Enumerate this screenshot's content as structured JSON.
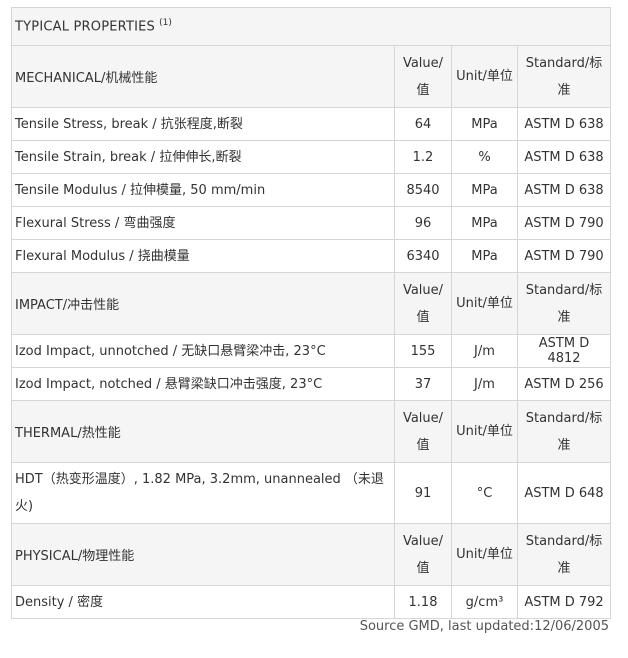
{
  "title": "TYPICAL PROPERTIES",
  "title_note": "(1)",
  "sections": [
    {
      "name": "MECHANICAL/机械性能",
      "col_value": "Value/值",
      "col_unit": "Unit/单位",
      "col_standard": "Standard/标准",
      "rows": [
        {
          "property": "Tensile Stress, break / 抗张程度,断裂",
          "value": "64",
          "unit": "MPa",
          "standard": "ASTM D 638"
        },
        {
          "property": "Tensile Strain, break / 拉伸伸长,断裂",
          "value": "1.2",
          "unit": "%",
          "standard": "ASTM D 638"
        },
        {
          "property": "Tensile Modulus / 拉伸模量, 50 mm/min",
          "value": "8540",
          "unit": "MPa",
          "standard": "ASTM D 638"
        },
        {
          "property": "Flexural Stress / 弯曲强度",
          "value": "96",
          "unit": "MPa",
          "standard": "ASTM D 790"
        },
        {
          "property": "Flexural Modulus / 挠曲模量",
          "value": "6340",
          "unit": "MPa",
          "standard": "ASTM D 790"
        }
      ]
    },
    {
      "name": "IMPACT/冲击性能",
      "col_value": "Value/值",
      "col_unit": "Unit/单位",
      "col_standard": "Standard/标准",
      "rows": [
        {
          "property": "Izod Impact, unnotched / 无缺口悬臂梁冲击, 23°C",
          "value": "155",
          "unit": "J/m",
          "standard": "ASTM D 4812"
        },
        {
          "property": "Izod Impact, notched / 悬臂梁缺口冲击强度, 23°C",
          "value": "37",
          "unit": "J/m",
          "standard": "ASTM D 256"
        }
      ]
    },
    {
      "name": "THERMAL/热性能",
      "col_value": "Value/值",
      "col_unit": "Unit/单位",
      "col_standard": "Standard/标准",
      "rows": [
        {
          "property": "HDT（热变形温度）, 1.82 MPa, 3.2mm, unannealed （未退火)",
          "value": "91",
          "unit": "°C",
          "standard": "ASTM D 648"
        }
      ]
    },
    {
      "name": "PHYSICAL/物理性能",
      "col_value": "Value/值",
      "col_unit": "Unit/单位",
      "col_standard": "Standard/标准",
      "rows": [
        {
          "property": "Density / 密度",
          "value": "1.18",
          "unit": "g/cm³",
          "standard": "ASTM D 792"
        }
      ]
    }
  ],
  "footer": "Source GMD, last updated:12/06/2005"
}
